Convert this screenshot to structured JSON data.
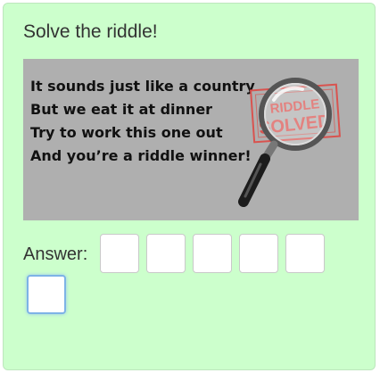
{
  "puzzle": {
    "title": "Solve the riddle!",
    "riddle_lines": [
      "It sounds just like a country",
      "But we eat it at dinner",
      "Try to work this one out",
      "And you’re a riddle winner!"
    ],
    "stamp_top": "RIDDLE",
    "stamp_bottom": "SOLVED",
    "stamp_color": "#d9534f"
  },
  "answer": {
    "label": "Answer:",
    "letters": [
      "",
      "",
      "",
      "",
      "",
      ""
    ],
    "active_index": 5
  }
}
